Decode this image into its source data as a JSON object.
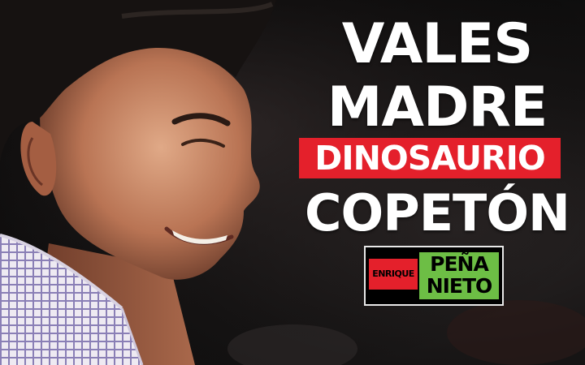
{
  "poster": {
    "headline": [
      "VALES",
      "MADRE",
      "DINOSAURIO",
      "COPETÓN"
    ],
    "highlight_color": "#e4202b"
  },
  "logo": {
    "first_name": "ENRIQUE",
    "last_name_line1": "PEÑA",
    "last_name_line2": "NIETO",
    "colors": {
      "red": "#e4202b",
      "green": "#6dbe45"
    }
  },
  "photo": {
    "subject": "smiling man in checked shirt, profile view"
  }
}
